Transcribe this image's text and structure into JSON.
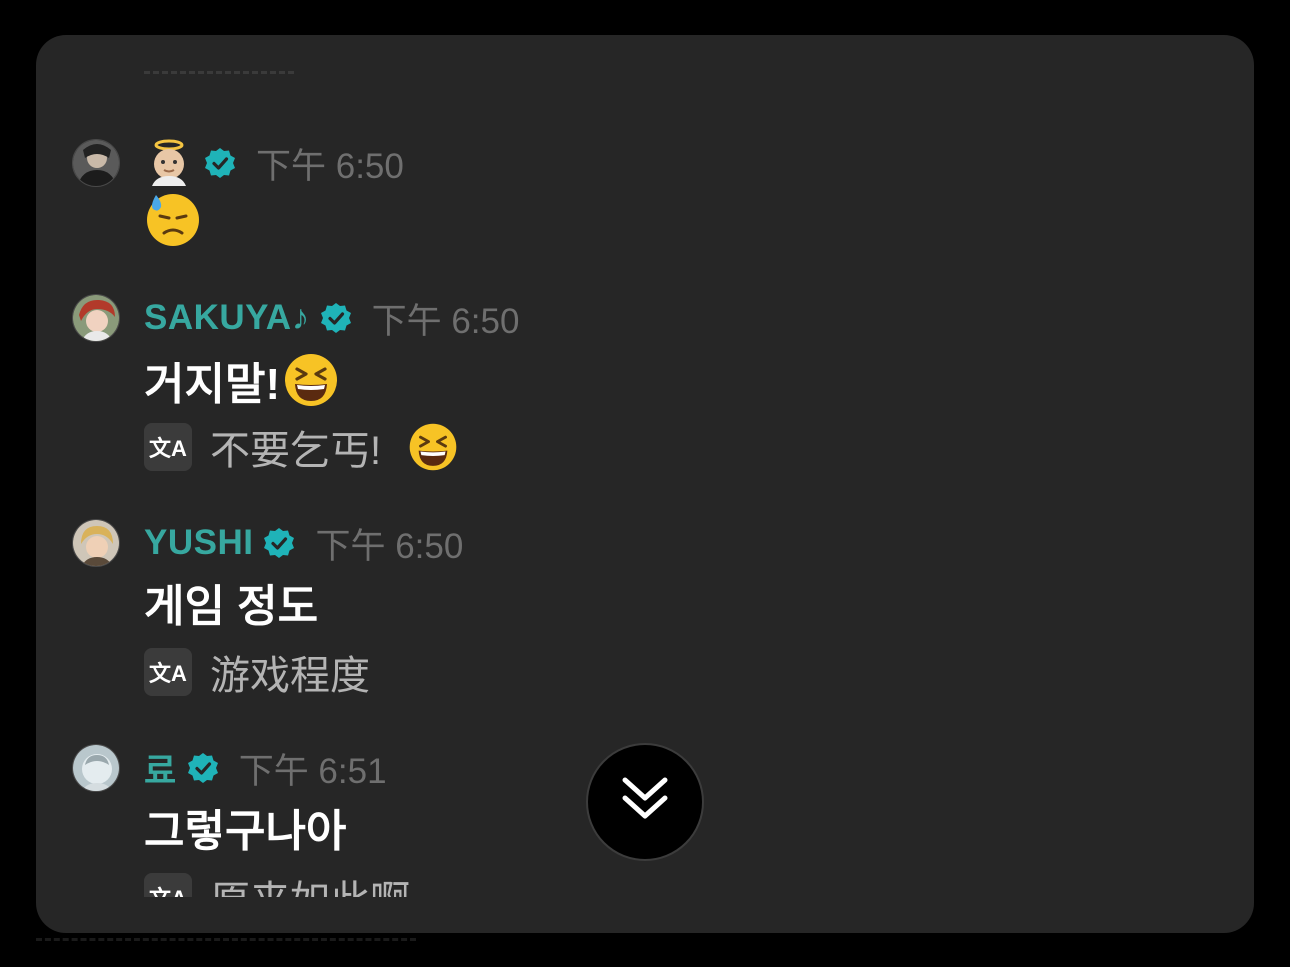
{
  "messages": [
    {
      "username": "",
      "name_emoji": "baby-angel-emoji",
      "time": "下午 6:50",
      "text": "",
      "text_emoji": "downcast-face-with-sweat-emoji",
      "avatar": "dark-hoodie-avatar"
    },
    {
      "username": "SAKUYA♪",
      "time": "下午 6:50",
      "text": "거지말!",
      "text_emoji": "grinning-squinting-face-emoji",
      "translation": "不要乞丐!",
      "translation_emoji": "grinning-squinting-face-emoji",
      "avatar": "red-hair-avatar"
    },
    {
      "username": "YUSHI",
      "time": "下午 6:50",
      "text": "게임 정도",
      "translation": "游戏程度",
      "avatar": "blond-avatar"
    },
    {
      "username": "료",
      "time": "下午 6:51",
      "text": "그렇구나아",
      "translation": "原来如此啊",
      "avatar": "light-blue-avatar"
    }
  ],
  "translate_icon_glyph": "文A",
  "scroll_button": {
    "icon": "double-chevron-down-icon"
  },
  "colors": {
    "panel": "#262626",
    "username": "#37a8a0",
    "verified": "#1fb3b8",
    "time": "#6f6f6f",
    "translation": "#b4b4b4"
  }
}
